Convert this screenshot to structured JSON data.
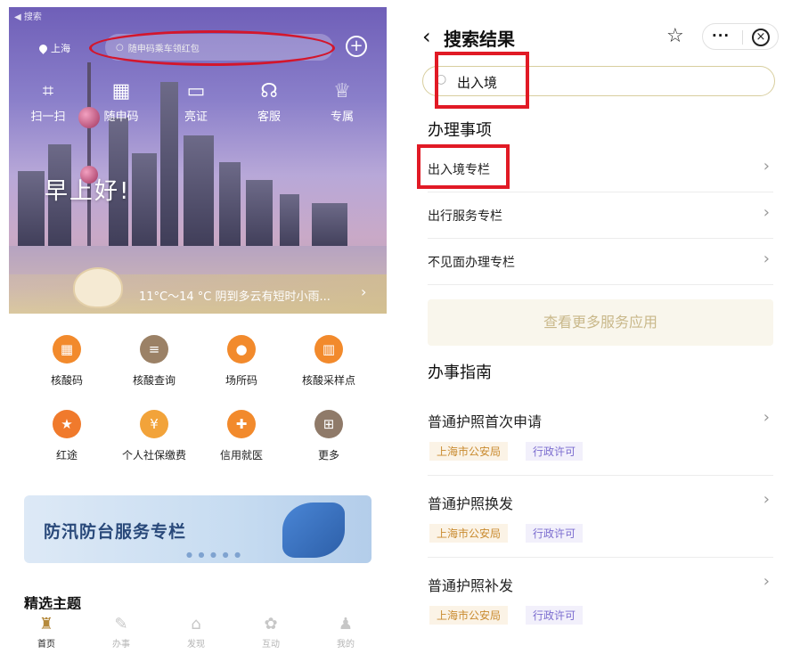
{
  "left": {
    "back_label": "◀ 搜索",
    "location": "上海",
    "search_placeholder": "随申码乘车领红包",
    "quick_actions": [
      {
        "label": "扫一扫",
        "icon": "scan-icon"
      },
      {
        "label": "随申码",
        "icon": "qr-code-icon"
      },
      {
        "label": "亮证",
        "icon": "id-card-icon"
      },
      {
        "label": "客服",
        "icon": "headset-icon"
      },
      {
        "label": "专属",
        "icon": "crown-icon"
      }
    ],
    "greeting": "早上好!",
    "weather": "11°C～14 °C 阴到多云有短时小雨...",
    "services": [
      {
        "label": "核酸码",
        "icon": "qr-code-icon",
        "color": "#f28a2c"
      },
      {
        "label": "核酸查询",
        "icon": "document-icon",
        "color": "#9b8166"
      },
      {
        "label": "场所码",
        "icon": "location-pin-icon",
        "color": "#f28a2c"
      },
      {
        "label": "核酸采样点",
        "icon": "building-icon",
        "color": "#f28a2c"
      },
      {
        "label": "红途",
        "icon": "star-icon",
        "color": "#f07a2c"
      },
      {
        "label": "个人社保缴费",
        "icon": "payment-icon",
        "color": "#f2a33a"
      },
      {
        "label": "信用就医",
        "icon": "medical-card-icon",
        "color": "#f28a2c"
      },
      {
        "label": "更多",
        "icon": "more-grid-icon",
        "color": "#8f7a69"
      }
    ],
    "banner": "防汛防台服务专栏",
    "section_title": "精选主题",
    "tabs": [
      {
        "label": "首页",
        "icon": "home-icon",
        "active": true
      },
      {
        "label": "办事",
        "icon": "pen-icon",
        "active": false
      },
      {
        "label": "发现",
        "icon": "discover-icon",
        "active": false
      },
      {
        "label": "互动",
        "icon": "flower-icon",
        "active": false
      },
      {
        "label": "我的",
        "icon": "profile-icon",
        "active": false
      }
    ]
  },
  "right": {
    "title": "搜索结果",
    "search_value": "出入境",
    "section1": "办理事项",
    "items": [
      "出入境专栏",
      "出行服务专栏",
      "不见面办理专栏"
    ],
    "more_button": "查看更多服务应用",
    "section2": "办事指南",
    "guides": [
      {
        "title": "普通护照首次申请",
        "tag1": "上海市公安局",
        "tag2": "行政许可"
      },
      {
        "title": "普通护照换发",
        "tag1": "上海市公安局",
        "tag2": "行政许可"
      },
      {
        "title": "普通护照补发",
        "tag1": "上海市公安局",
        "tag2": "行政许可"
      }
    ]
  }
}
